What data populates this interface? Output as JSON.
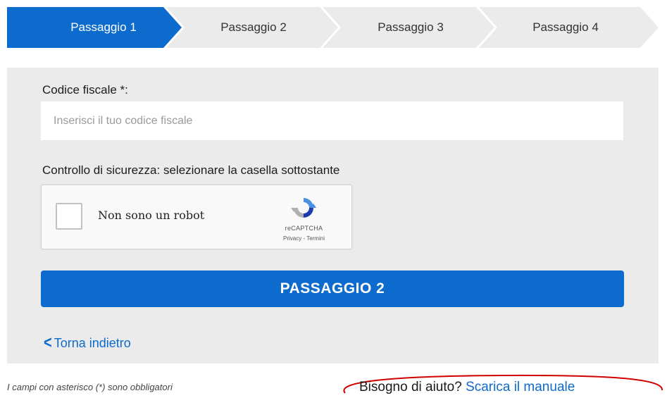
{
  "stepper": {
    "steps": [
      {
        "label": "Passaggio 1",
        "active": true
      },
      {
        "label": "Passaggio 2",
        "active": false
      },
      {
        "label": "Passaggio 3",
        "active": false
      },
      {
        "label": "Passaggio 4",
        "active": false
      }
    ],
    "active_color": "#0d6bce",
    "inactive_color": "#ebebeb"
  },
  "form": {
    "codice_fiscale_label": "Codice fiscale *:",
    "codice_fiscale_placeholder": "Inserisci il tuo codice fiscale",
    "codice_fiscale_value": "",
    "security_label": "Controllo di sicurezza: selezionare la casella sottostante",
    "captcha": {
      "checkbox_label": "Non sono un robot",
      "brand": "reCAPTCHA",
      "links": "Privacy - Termini",
      "checked": false
    },
    "submit_label": "PASSAGGIO 2",
    "back_label": "Torna indietro"
  },
  "footer": {
    "required_note": "I campi con asterisco (*) sono obbligatori",
    "help_question": "Bisogno di aiuto?",
    "help_link": "Scarica il manuale"
  },
  "colors": {
    "primary": "#0d6bce",
    "panel_bg": "#ebebeb",
    "highlight_circle": "#d00000"
  },
  "icons": {
    "captcha_logo": "recaptcha-icon",
    "back": "chevron-left-icon"
  }
}
